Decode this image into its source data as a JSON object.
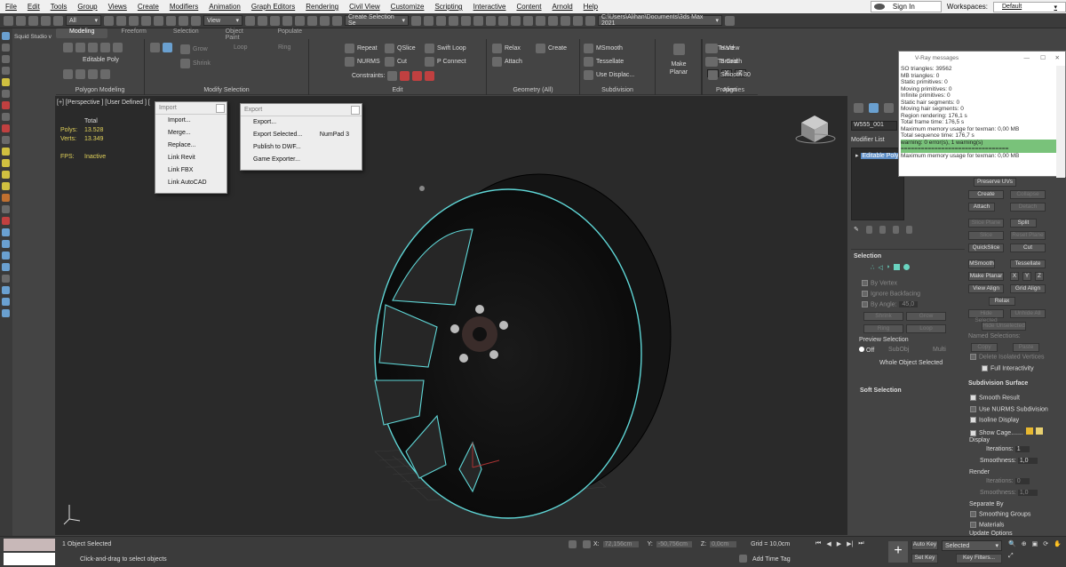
{
  "menubar": {
    "items": [
      "File",
      "Edit",
      "Tools",
      "Group",
      "Views",
      "Create",
      "Modifiers",
      "Animation",
      "Graph Editors",
      "Rendering",
      "Civil View",
      "Customize",
      "Scripting",
      "Interactive",
      "Content",
      "Arnold",
      "Help"
    ],
    "signin": "Sign In",
    "workspaces_label": "Workspaces:",
    "workspace": "Default"
  },
  "toolbar": {
    "filter": "All",
    "viewref": "View",
    "selset": "Create Selection Se",
    "path": "C:\\Users\\Alihan\\Documents\\3ds Max 2021"
  },
  "ribbon": {
    "tabs": [
      "Modeling",
      "Freeform",
      "Selection",
      "Object Paint",
      "Populate"
    ],
    "editable_poly": "Editable Poly",
    "polygon_modeling": "Polygon Modeling",
    "modify_selection": "Modify Selection",
    "grow": "Grow",
    "shrink": "Shrink",
    "loop": "Loop",
    "ring": "Ring",
    "edit": "Edit",
    "repeat": "Repeat",
    "qslice": "QSlice",
    "swift_loop": "Swift Loop",
    "nurms": "NURMS",
    "cut": "Cut",
    "p_connect": "P Connect",
    "constraints": "Constraints:",
    "relax": "Relax",
    "create": "Create",
    "attach": "Attach",
    "geometry_all": "Geometry (All)",
    "msmooth": "MSmooth",
    "tessellate": "Tessellate",
    "use_displac": "Use Displac...",
    "make_planar": "Make Planar",
    "subdivision": "Subdivision",
    "to_view": "To View",
    "to_grid": "To Grid",
    "x": "X",
    "y": "Y",
    "z": "Z",
    "align": "Align",
    "hard": "Hard",
    "smooth": "Smooth",
    "smooth30": "Smooth 30",
    "properties": "Properties"
  },
  "sidebar": {
    "label": "Squid Studio v"
  },
  "viewport": {
    "label": "[+] [Perspective ] [User Defined ] [",
    "stats": {
      "total": "Total",
      "polys_label": "Polys:",
      "polys": "13.528",
      "verts_label": "Verts:",
      "verts": "13.349",
      "fps_label": "FPS:",
      "fps": "Inactive"
    }
  },
  "import_menu": {
    "title": "Import",
    "items": [
      "Import...",
      "Merge...",
      "Replace...",
      "Link Revit",
      "Link FBX",
      "Link AutoCAD"
    ]
  },
  "export_menu": {
    "title": "Export",
    "items": [
      "Export...",
      "Export Selected...",
      "Publish to DWF...",
      "Game Exporter..."
    ],
    "shortcut": "NumPad 3"
  },
  "vray": {
    "title": "V-Ray messages",
    "lines": [
      "SO triangles: 39562",
      "MB triangles: 0",
      "Static primitives: 0",
      "Moving primitives: 0",
      "Infinite primitives: 0",
      "Static hair segments: 0",
      "Moving hair segments: 0",
      "Region rendering: 176,1 s",
      "Total frame time: 176,5 s",
      "Maximum memory usage for texman: 0,00 MB",
      "Total sequence time: 176,7 s"
    ],
    "warning": "warning: 0 error(s), 1 warning(s)",
    "divider": "================================",
    "last": "Maximum memory usage for texman: 0,00 MB"
  },
  "command_panel": {
    "object_name": "W555_001",
    "modifier_list": "Modifier List",
    "stack_item": "Editable Poly",
    "selection": "Selection",
    "by_vertex": "By Vertex",
    "ignore_backfacing": "Ignore Backfacing",
    "by_angle": "By Angle:",
    "angle": "45,0",
    "shrink": "Shrink",
    "grow": "Grow",
    "ring": "Ring",
    "loop": "Loop",
    "preview_selection": "Preview Selection",
    "off": "Off",
    "subobj": "SubObj",
    "multi": "Multi",
    "whole_object": "Whole Object Selected",
    "soft_selection": "Soft Selection",
    "preserve_uvs": "Preserve UVs",
    "create": "Create",
    "collapse": "Collapse",
    "attach": "Attach",
    "detach": "Detach",
    "slice_plane": "Slice Plane",
    "split": "Split",
    "slice": "Slice",
    "reset_plane": "Reset Plane",
    "quickslice": "QuickSlice",
    "cut": "Cut",
    "msmooth": "MSmooth",
    "tessellate": "Tessellate",
    "make_planar": "Make Planar",
    "x": "X",
    "y": "Y",
    "z": "Z",
    "view_align": "View Align",
    "grid_align": "Grid Align",
    "relax": "Relax",
    "hide_selected": "Hide Selected",
    "unhide_all": "Unhide All",
    "hide_unselected": "Hide Unselected",
    "named_selections": "Named Selections:",
    "copy": "Copy",
    "paste": "Paste",
    "delete_isolated": "Delete Isolated Vertices",
    "full_interactivity": "Full Interactivity",
    "subdivision_surface": "Subdivision Surface",
    "smooth_result": "Smooth Result",
    "use_nurms": "Use NURMS Subdivision",
    "isoline": "Isoline Display",
    "show_cage": "Show Cage.......",
    "display": "Display",
    "iterations_label": "Iterations:",
    "iterations": "1",
    "smoothness_label": "Smoothness:",
    "smoothness": "1,0",
    "render": "Render",
    "r_iterations": "0",
    "r_smoothness": "1,0",
    "separate_by": "Separate By",
    "smoothing_groups": "Smoothing Groups",
    "materials": "Materials",
    "update_options": "Update Options"
  },
  "status": {
    "selected": "1 Object Selected",
    "hint": "Click-and-drag to select objects",
    "x_label": "X:",
    "x": "72,156cm",
    "y_label": "Y:",
    "y": "-50,756cm",
    "z_label": "Z:",
    "z": "0,0cm",
    "grid": "Grid = 10,0cm",
    "add_time_tag": "Add Time Tag",
    "auto_key": "Auto Key",
    "set_key": "Set Key",
    "selected_dd": "Selected",
    "key_filters": "Key Filters..."
  }
}
